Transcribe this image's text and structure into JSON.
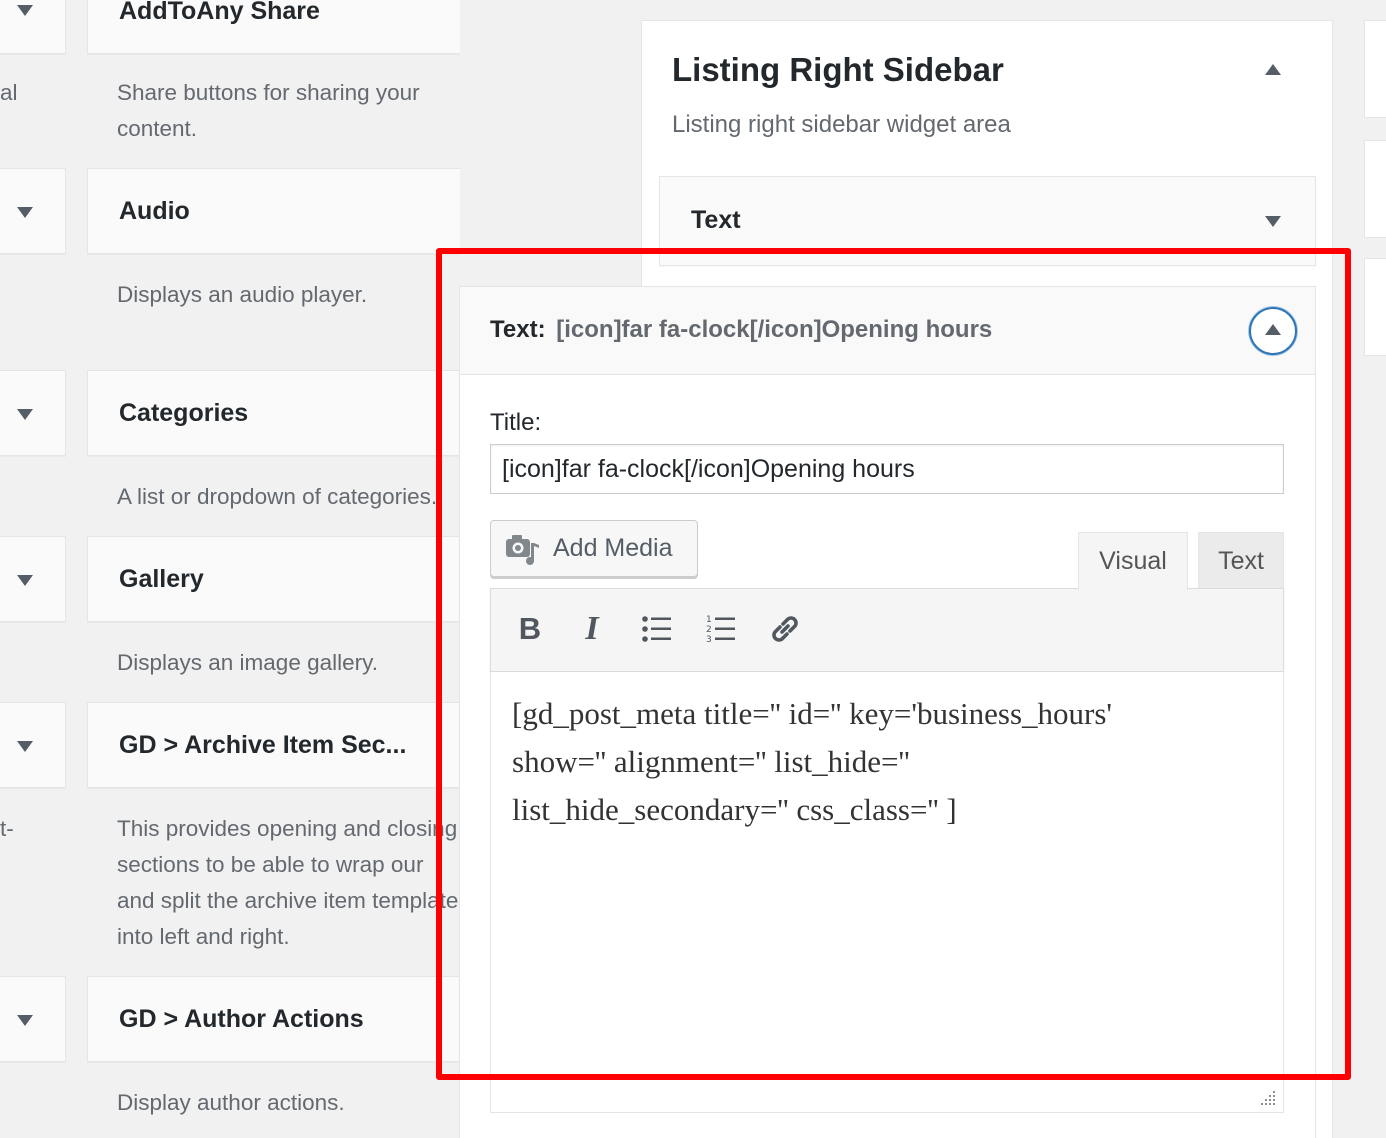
{
  "left_widgets": [
    {
      "title": "AddToAny Share",
      "description": [
        "Share buttons for sharing your",
        "content."
      ]
    },
    {
      "title": "Audio",
      "description": [
        "Displays an audio player."
      ]
    },
    {
      "title": "Categories",
      "description": [
        "A list or dropdown of categories."
      ]
    },
    {
      "title": "Gallery",
      "description": [
        "Displays an image gallery."
      ]
    },
    {
      "title": "GD > Archive Item Sec...",
      "description": [
        "This provides opening and closing",
        "sections to be able to wrap our",
        "and split the archive item template",
        "into left and right."
      ]
    },
    {
      "title": "GD > Author Actions",
      "description": [
        "Display author actions."
      ]
    }
  ],
  "left_edge_fragments": [
    "al",
    "t-"
  ],
  "sidebar": {
    "title": "Listing Right Sidebar",
    "description": "Listing right sidebar widget area",
    "collapsed_widget_title": "Text"
  },
  "editor_widget": {
    "header_label": "Text:",
    "header_value": "[icon]far fa-clock[/icon]Opening hours",
    "title_label": "Title:",
    "title_value": "[icon]far fa-clock[/icon]Opening hours",
    "add_media_label": "Add Media",
    "tabs": {
      "visual": "Visual",
      "text": "Text"
    },
    "content_lines": [
      "[gd_post_meta title='' id='' key='business_hours'",
      "show='' alignment='' list_hide=''",
      "list_hide_secondary='' css_class='' ]"
    ]
  },
  "colors": {
    "highlight_border": "#ff0000",
    "focus_blue": "#2f76b5",
    "background": "#f1f1f1"
  }
}
